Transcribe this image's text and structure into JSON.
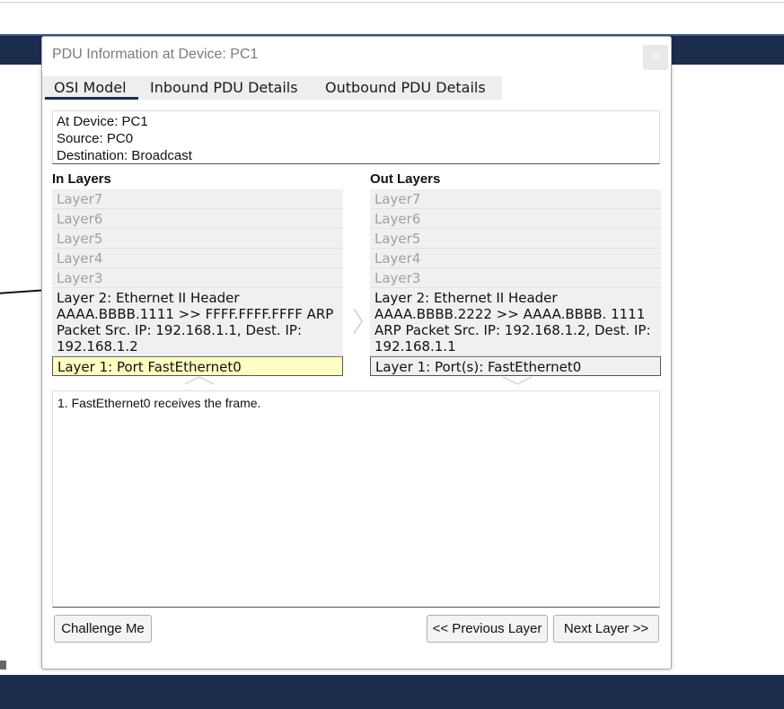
{
  "dialog": {
    "title": "PDU Information at Device: PC1",
    "close_label": "×"
  },
  "tabs": [
    {
      "label": "OSI Model",
      "active": true
    },
    {
      "label": "Inbound PDU Details",
      "active": false
    },
    {
      "label": "Outbound PDU Details",
      "active": false
    }
  ],
  "info": {
    "at_device": "At Device: PC1",
    "source": "Source: PC0",
    "destination": "Destination: Broadcast"
  },
  "in_layers": {
    "heading": "In Layers",
    "items": [
      "Layer7",
      "Layer6",
      "Layer5",
      "Layer4",
      "Layer3",
      "Layer 2: Ethernet II Header AAAA.BBBB.1111 >> FFFF.FFFF.FFFF ARP Packet Src. IP: 192.168.1.1, Dest. IP: 192.168.1.2",
      "Layer 1: Port FastEthernet0"
    ]
  },
  "out_layers": {
    "heading": "Out Layers",
    "items": [
      "Layer7",
      "Layer6",
      "Layer5",
      "Layer4",
      "Layer3",
      "Layer 2: Ethernet II Header AAAA.BBBB.2222 >> AAAA.BBBB. 1111 ARP Packet Src. IP: 192.168.1.2, Dest. IP: 192.168.1.1",
      "Layer 1: Port(s): FastEthernet0"
    ]
  },
  "description": "1. FastEthernet0 receives the frame.",
  "buttons": {
    "challenge": "Challenge Me",
    "previous": "<< Previous Layer",
    "next": "Next Layer >>"
  },
  "colors": {
    "nav_band": "#1b2c4d",
    "selected_layer": "#ffffc4",
    "layer_bg": "#f0f0f0"
  }
}
